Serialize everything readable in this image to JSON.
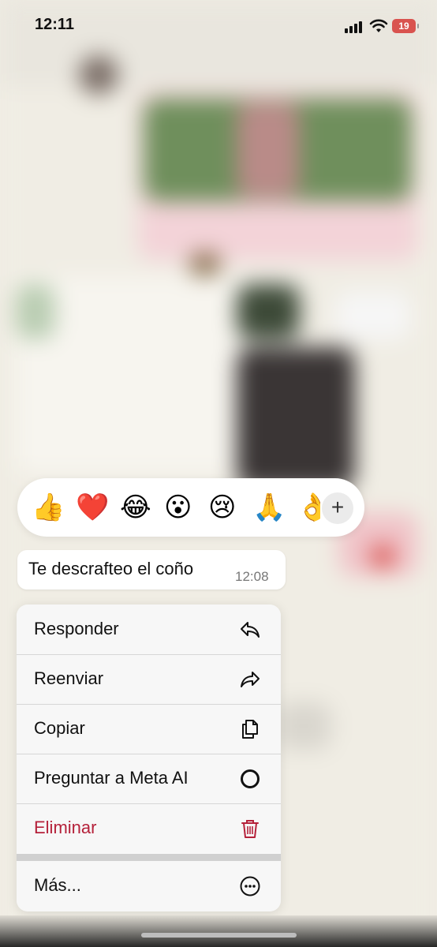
{
  "status_bar": {
    "time": "12:11",
    "battery": "19",
    "battery_color": "#d9534f"
  },
  "reactions": {
    "emojis": [
      "👍",
      "❤️",
      "😂",
      "😮",
      "😢",
      "🙏",
      "👌"
    ],
    "plus_label": "+"
  },
  "message": {
    "text": "Te descrafteo el coño",
    "time": "12:08"
  },
  "menu": {
    "items": [
      {
        "label": "Responder",
        "icon": "reply-icon"
      },
      {
        "label": "Reenviar",
        "icon": "forward-icon"
      },
      {
        "label": "Copiar",
        "icon": "copy-icon"
      },
      {
        "label": "Preguntar a Meta AI",
        "icon": "meta-ai-icon"
      },
      {
        "label": "Eliminar",
        "icon": "trash-icon",
        "color": "#b5213a"
      },
      {
        "label": "Más...",
        "icon": "more-icon"
      }
    ]
  }
}
